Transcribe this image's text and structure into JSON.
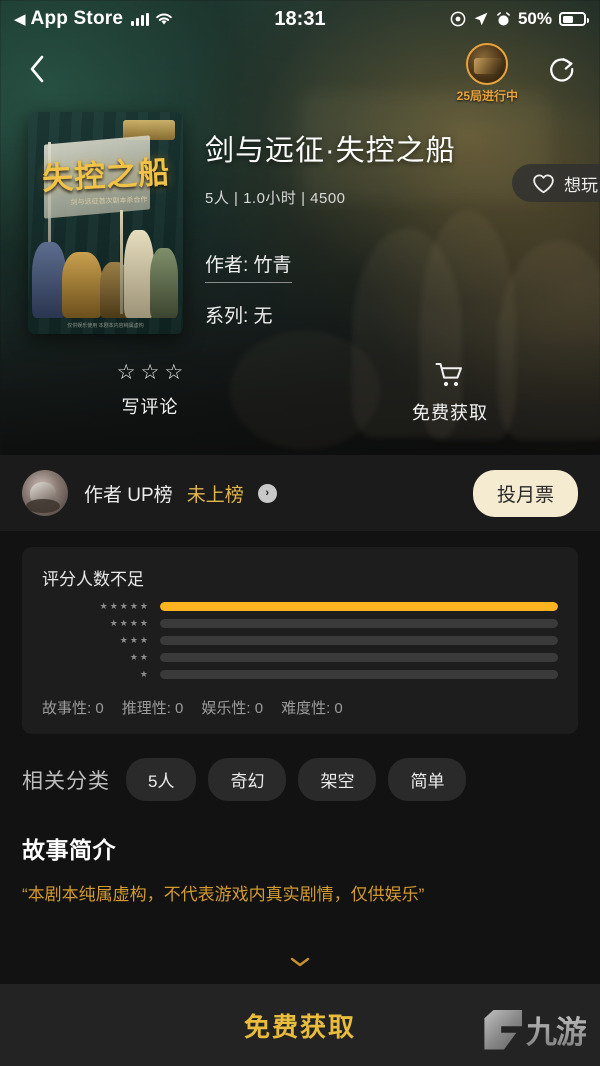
{
  "status_bar": {
    "back_arrow": "◀",
    "carrier": "App Store",
    "time": "18:31",
    "battery_percent": "50%",
    "icons": [
      "signal-bars-icon",
      "wifi-icon",
      "record-icon",
      "location-icon",
      "alarm-icon",
      "battery-icon"
    ]
  },
  "nav": {
    "back_icon": "‹",
    "live_badge_label": "25局进行中",
    "share_icon": "share-icon"
  },
  "hero": {
    "cover": {
      "title": "失控之船",
      "subtitle": "剑与远征首次剧本杀合作",
      "footer": "仅供娱乐使用\n本剧本内容纯属虚构"
    },
    "title": "剑与远征·失控之船",
    "meta": "5人 | 1.0小时 | 4500",
    "wish_button": "想玩",
    "heart_icon": "heart-outline-icon",
    "author": "作者: 竹青",
    "series": "系列: 无",
    "actions": [
      {
        "label": "写评论",
        "icon": "three-stars-icon",
        "stars": "☆☆☆"
      },
      {
        "label": "免费获取",
        "icon": "shopping-cart-icon"
      }
    ]
  },
  "up_board": {
    "avatar": "author-avatar",
    "label": "作者 UP榜",
    "status": "未上榜",
    "chevron_icon": "chevron-right-icon",
    "vote_button": "投月票"
  },
  "rating": {
    "title": "评分人数不足",
    "bars": [
      {
        "stars": "★★★★★",
        "percent": 100
      },
      {
        "stars": "★★★★",
        "percent": 0
      },
      {
        "stars": "★★★",
        "percent": 0
      },
      {
        "stars": "★★",
        "percent": 0
      },
      {
        "stars": "★",
        "percent": 0
      }
    ],
    "subscores": [
      "故事性: 0",
      "推理性: 0",
      "娱乐性: 0",
      "难度性: 0"
    ]
  },
  "categories": {
    "label": "相关分类",
    "chips": [
      "5人",
      "奇幻",
      "架空",
      "简单"
    ]
  },
  "synopsis": {
    "title": "故事简介",
    "text": "“本剧本纯属虚构，不代表游戏内真实剧情，仅供娱乐”"
  },
  "expand": {
    "icon": "chevron-down-icon",
    "glyph": "⌄"
  },
  "bottom_bar": {
    "cta": "免费获取"
  },
  "watermark": {
    "text": "九游",
    "mark": "jiuyou-logo-icon"
  },
  "colors": {
    "accent_gold": "#e9bc3d",
    "rating_bar": "#fcb521",
    "synopsis_text": "#d39a2e",
    "vote_button_bg": "#f5ebd0",
    "page_bg": "#121212"
  }
}
